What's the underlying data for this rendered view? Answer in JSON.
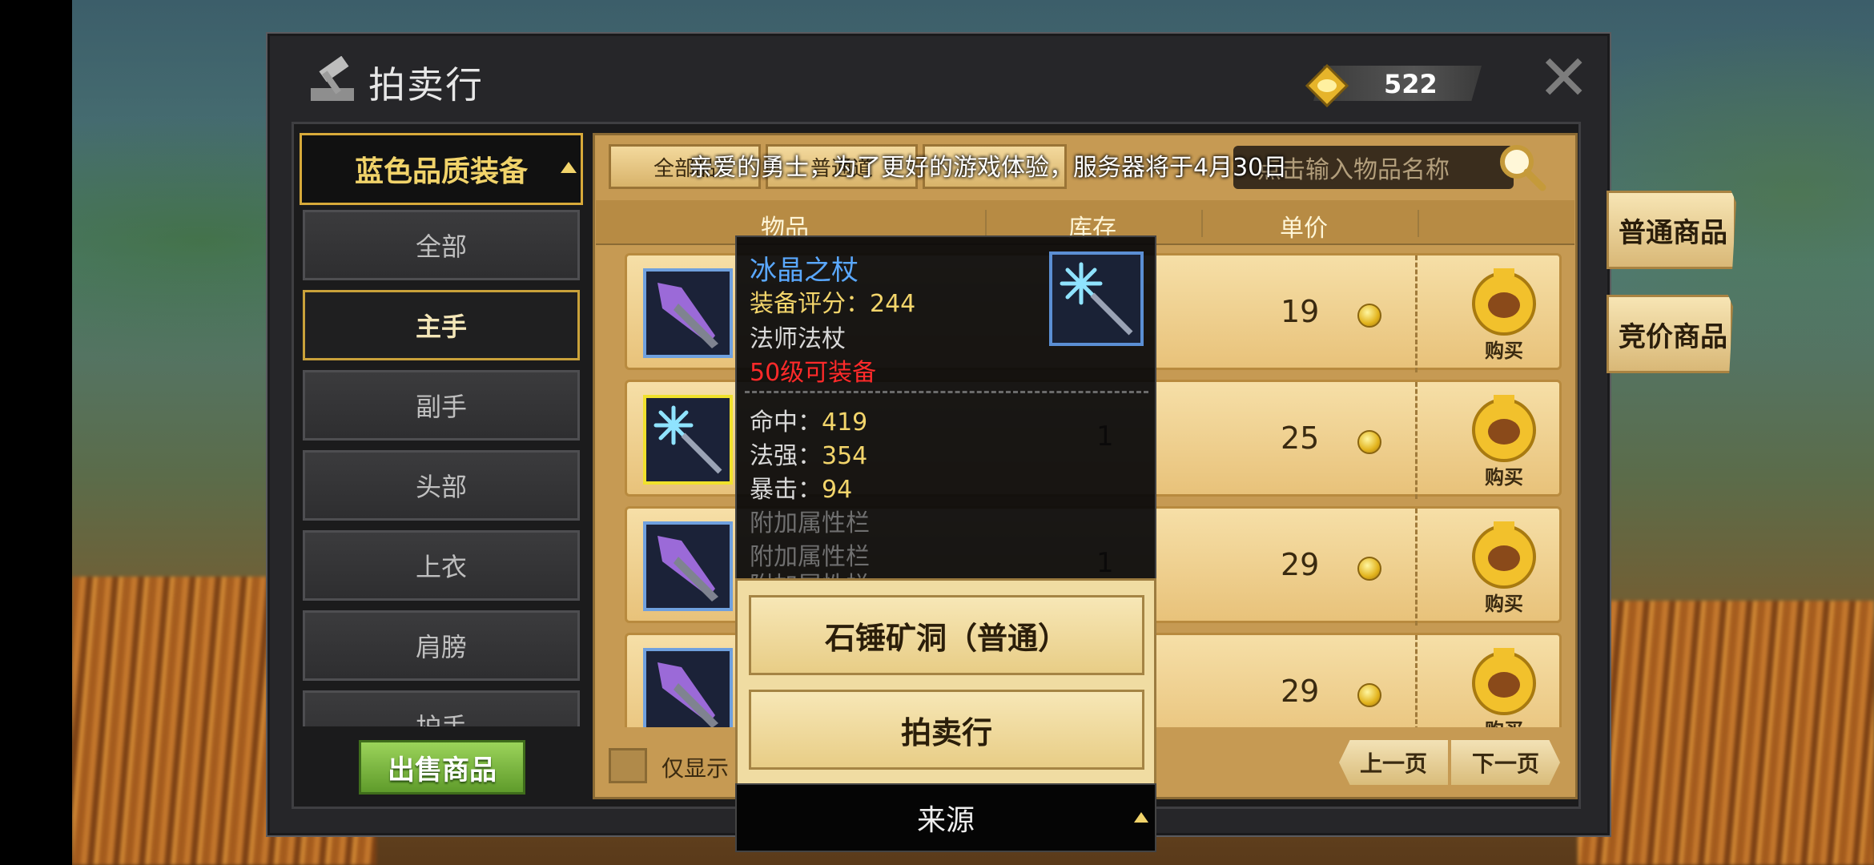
{
  "window": {
    "title": "拍卖行",
    "coin_amount": "522"
  },
  "categories": {
    "header": "蓝色品质装备",
    "items": [
      {
        "label": "全部",
        "active": false
      },
      {
        "label": "主手",
        "active": true
      },
      {
        "label": "副手",
        "active": false
      },
      {
        "label": "头部",
        "active": false
      },
      {
        "label": "上衣",
        "active": false
      },
      {
        "label": "肩膀",
        "active": false
      },
      {
        "label": "护手",
        "active": false
      }
    ]
  },
  "sell_button": "出售商品",
  "filter_tabs": [
    "全部品",
    "普通道",
    ""
  ],
  "search": {
    "placeholder": "点击输入物品名称"
  },
  "notice": "亲爱的勇士，为了更好的游戏体验，服务器将于4月30日",
  "columns": {
    "item": "物品",
    "stock": "库存",
    "price": "单价"
  },
  "rows": [
    {
      "item_type": "purple-staff",
      "stock": "",
      "price": "19",
      "buy": "购买"
    },
    {
      "item_type": "ice-crystal-staff",
      "stock": "1",
      "price": "25",
      "buy": "购买"
    },
    {
      "item_type": "purple-staff",
      "stock": "1",
      "price": "29",
      "buy": "购买"
    },
    {
      "item_type": "purple-staff",
      "stock": "",
      "price": "29",
      "buy": "购买"
    }
  ],
  "only_show_label": "仅显示",
  "pagination": {
    "prev": "上一页",
    "next": "下一页"
  },
  "side_tabs": {
    "normal": "普通商品",
    "bid": "竞价商品"
  },
  "tooltip": {
    "name": "冰晶之杖",
    "score_label": "装备评分：",
    "score": "244",
    "type": "法师法杖",
    "level_req": "50级可装备",
    "stats": [
      {
        "label": "命中：",
        "value": "419"
      },
      {
        "label": "法强：",
        "value": "354"
      },
      {
        "label": "暴击：",
        "value": "94"
      }
    ],
    "extra_slots": [
      "附加属性栏",
      "附加属性栏",
      "附加属性栏"
    ]
  },
  "source": {
    "buttons": [
      "石锤矿洞（普通）",
      "拍卖行"
    ],
    "footer": "来源"
  },
  "colors": {
    "accent_gold": "#d8aa3a",
    "name_blue": "#5aa8ff",
    "req_red": "#ff2a2a",
    "sell_green": "#6aa835"
  }
}
